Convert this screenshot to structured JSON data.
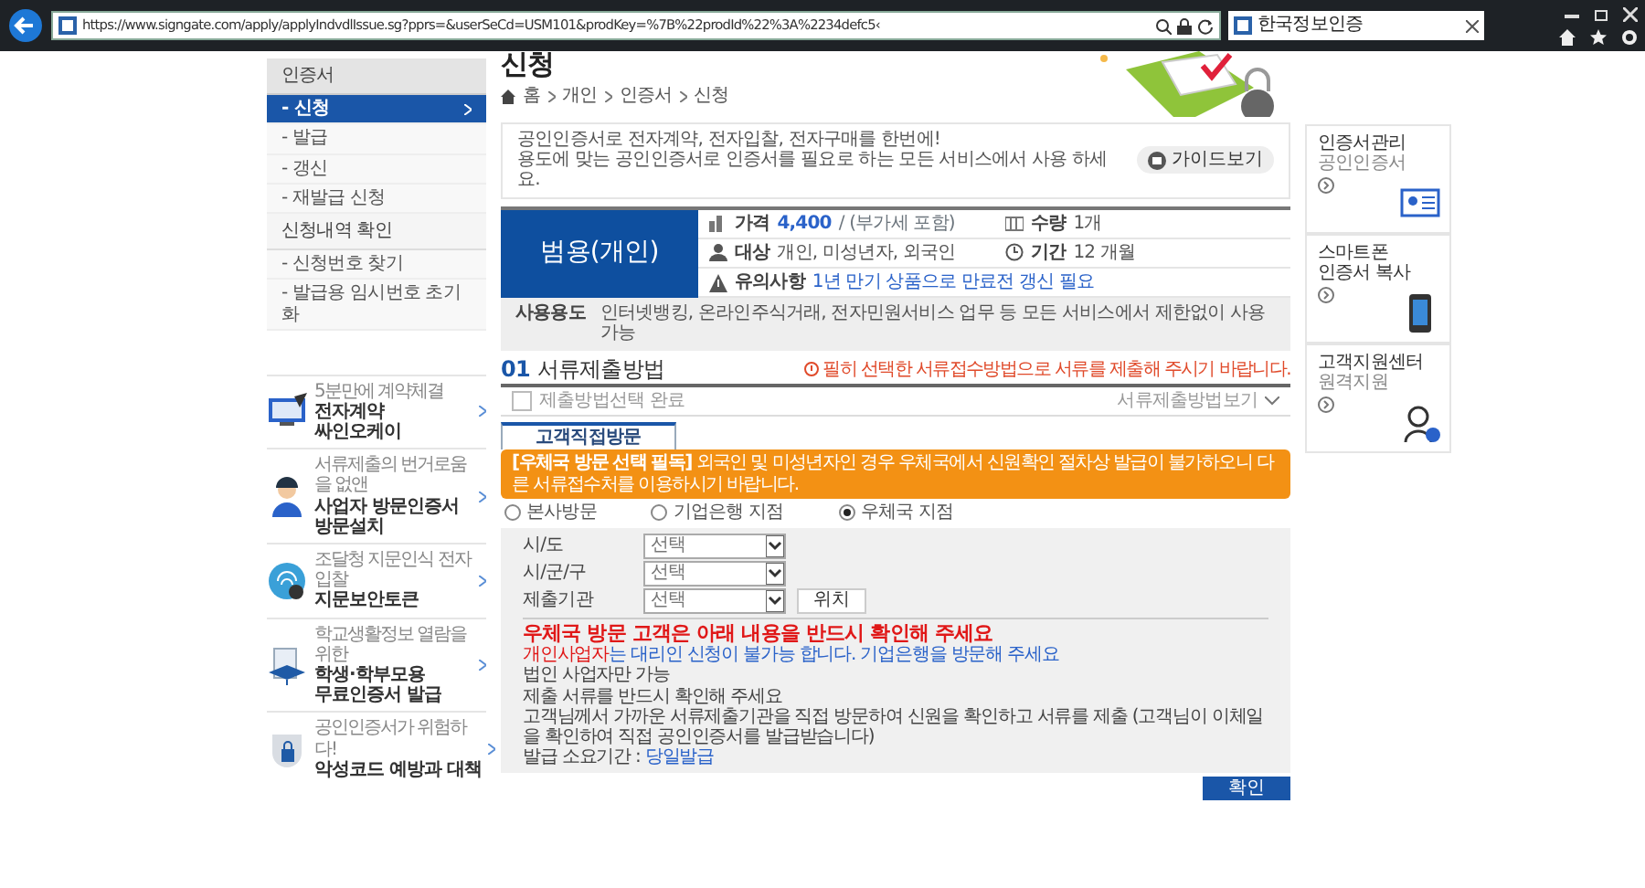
{
  "browser": {
    "url": "https://www.signgate.com/apply/applyIndvdlIssue.sg?pprs=&userSeCd=USM101&prodKey=%7B%22prodId%22%3A%2234defc5‹",
    "tab_title": "한국정보인증"
  },
  "sidebar": {
    "menu": [
      {
        "label": "인증서",
        "children": [
          {
            "label": "- 신청",
            "selected": true
          },
          {
            "label": "- 발급",
            "selected": false
          },
          {
            "label": "- 갱신",
            "selected": false
          },
          {
            "label": "- 재발급 신청",
            "selected": false
          }
        ]
      },
      {
        "label": "신청내역 확인",
        "children": [
          {
            "label": "- 신청번호 찾기",
            "selected": false
          },
          {
            "label": "- 발급용 임시번호 초기화",
            "selected": false
          }
        ]
      }
    ],
    "promos": [
      {
        "kind": "contract",
        "caption": "5분만에 계약체결",
        "title_lines": [
          "전자계약",
          "싸인오케이"
        ]
      },
      {
        "kind": "visit",
        "caption": "서류제출의 번거로움을 없앤",
        "title_lines": [
          "사업자 방문인증서",
          "방문설치"
        ]
      },
      {
        "kind": "finger",
        "caption": "조달청 지문인식 전자입찰",
        "title_lines": [
          "지문보안토큰"
        ]
      },
      {
        "kind": "student",
        "caption": "학교생활정보 열람을 위한",
        "title_lines": [
          "학생·학부모용",
          "무료인증서 발급"
        ]
      },
      {
        "kind": "shield",
        "caption": "공인인증서가 위험하다!",
        "title_lines": [
          "악성코드 예방과 대책"
        ]
      }
    ]
  },
  "page": {
    "title": "신청",
    "breadcrumb": [
      "홈",
      "개인",
      "인증서",
      "신청"
    ],
    "intro": {
      "lines": [
        "공인인증서로 전자계약, 전자입찰, 전자구매를 한번에!",
        "용도에 맞는 공인인증서로 인증서를 필요로 하는 모든 서비스에서 사용 하세요."
      ],
      "guide_button": "가이드보기"
    },
    "product": {
      "name": "범용(개인)",
      "attributes": [
        {
          "kind": "price",
          "label": "가격",
          "value": "4,400",
          "note": "/ (부가세 포함)"
        },
        {
          "kind": "quantity",
          "label": "수량",
          "value": "1개"
        },
        {
          "kind": "target",
          "label": "대상",
          "value": "개인, 미성년자, 외국인"
        },
        {
          "kind": "period",
          "label": "기간",
          "value": "12 개월"
        },
        {
          "kind": "caution",
          "label": "유의사항",
          "value": "1년 만기 상품으로 만료전 갱신 필요"
        }
      ],
      "usage": {
        "label": "사용용도",
        "value": "인터넷뱅킹, 온라인주식거래, 전자민원서비스 업무 등 모든 서비스에서 제한없이 사용 가능"
      }
    },
    "section": {
      "number": "01",
      "title": "서류제출방법",
      "warning": "필히 선택한 서류접수방법으로 서류를 제출해 주시기 바랍니다.",
      "completion": {
        "label": "제출방법선택 완료",
        "checked": false
      },
      "toggle": "서류제출방법보기",
      "tabs": [
        {
          "label": "고객직접방문",
          "selected": true
        }
      ],
      "notice": "**[우체국 방문 선택 필독]** 외국인 및 미성년자인 경우 우체국에서 신원확인 절차상 발급이 불가하오니 다른 서류접수처를 이용하시기 바랍니다.",
      "options": [
        {
          "label": "본사방문",
          "selected": false
        },
        {
          "label": "기업은행 지점",
          "selected": false
        },
        {
          "label": "우체국 지점",
          "selected": true
        }
      ],
      "fields": [
        {
          "label": "시/도",
          "value": "선택"
        },
        {
          "label": "시/군/구",
          "value": "선택"
        },
        {
          "label": "제출기관",
          "value": "선택",
          "button": "위치"
        }
      ],
      "notes": {
        "heading": "우체국 방문 고객은 아래 내용을 반드시 확인해 주세요",
        "items": [
          [
            {
              "color": "#e01818",
              "text": "개인사업자"
            },
            {
              "color": "#2a62c9",
              "text": "는 대리인 신청이 불가능 합니다. 기업은행을 방문해 주세요"
            }
          ],
          [
            {
              "text": "법인 사업자만 가능"
            }
          ],
          [
            {
              "text": "제출 서류를 반드시 확인해 주세요"
            }
          ],
          [
            {
              "text": "고객님께서 가까운 서류제출기관을 직접 방문하여 신원을 확인하고 서류를 제출 (고객님이 이체일을 확인하여 직접 공인인증서를 발급받습니다)"
            }
          ],
          [
            {
              "text": "발급 소요기간 : "
            },
            {
              "color": "#2a62c9",
              "text": "당일발급"
            }
          ]
        ]
      },
      "confirm_button": "확인"
    }
  },
  "quick_links": [
    {
      "kind": "cert",
      "title_lines": [
        "인증서관리"
      ],
      "subtitle": "공인인증서"
    },
    {
      "kind": "phone",
      "title_lines": [
        "스마트폰",
        "인증서 복사"
      ]
    },
    {
      "kind": "support",
      "title_lines": [
        "고객지원센터"
      ],
      "subtitle": "원격지원"
    }
  ]
}
